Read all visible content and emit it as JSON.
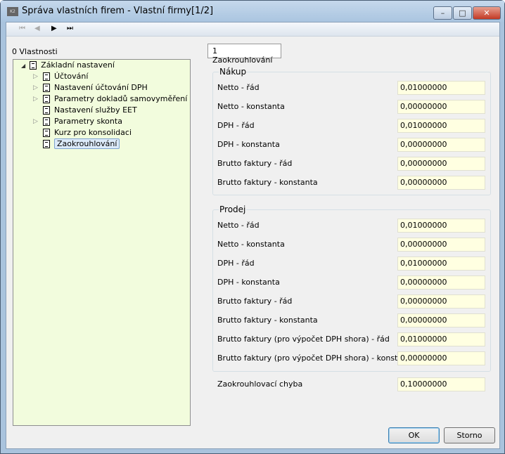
{
  "window": {
    "title": "Správa vlastních firem - Vlastní firmy[1/2]",
    "icon": "K2",
    "minimize": "–",
    "maximize": "□",
    "close": "✕"
  },
  "toolbar": {
    "first": "⏮",
    "prev": "◀",
    "next": "▶",
    "last": "⏭"
  },
  "tree": {
    "label": "0 Vlastnosti",
    "root": "Základní nastavení",
    "items": [
      {
        "label": "Účtování",
        "expandable": true
      },
      {
        "label": "Nastavení účtování DPH",
        "expandable": true
      },
      {
        "label": "Parametry dokladů samovyměření",
        "expandable": true
      },
      {
        "label": "Nastavení služby EET",
        "expandable": false
      },
      {
        "label": "Parametry skonta",
        "expandable": true
      },
      {
        "label": "Kurz pro konsolidaci",
        "expandable": false
      },
      {
        "label": "Zaokrouhlování",
        "expandable": false,
        "selected": true
      }
    ]
  },
  "tab": {
    "label": "1 Zaokrouhlování"
  },
  "nakup": {
    "title": "Nákup",
    "rows": [
      {
        "label": "Netto - řád",
        "value": "0,01000000"
      },
      {
        "label": "Netto - konstanta",
        "value": "0,00000000"
      },
      {
        "label": "DPH - řád",
        "value": "0,01000000"
      },
      {
        "label": "DPH - konstanta",
        "value": "0,00000000"
      },
      {
        "label": "Brutto faktury - řád",
        "value": "0,00000000"
      },
      {
        "label": "Brutto faktury - konstanta",
        "value": "0,00000000"
      }
    ]
  },
  "prodej": {
    "title": "Prodej",
    "rows": [
      {
        "label": "Netto - řád",
        "value": "0,01000000"
      },
      {
        "label": "Netto - konstanta",
        "value": "0,00000000"
      },
      {
        "label": "DPH - řád",
        "value": "0,01000000"
      },
      {
        "label": "DPH - konstanta",
        "value": "0,00000000"
      },
      {
        "label": "Brutto faktury - řád",
        "value": "0,00000000"
      },
      {
        "label": "Brutto faktury - konstanta",
        "value": "0,00000000"
      },
      {
        "label": "Brutto faktury (pro výpočet DPH shora) - řád",
        "value": "0,01000000"
      },
      {
        "label": "Brutto faktury (pro výpočet DPH shora) - konstanta",
        "value": "0,00000000"
      }
    ]
  },
  "error": {
    "label": "Zaokrouhlovací chyba",
    "value": "0,10000000"
  },
  "buttons": {
    "ok": "OK",
    "cancel": "Storno"
  }
}
